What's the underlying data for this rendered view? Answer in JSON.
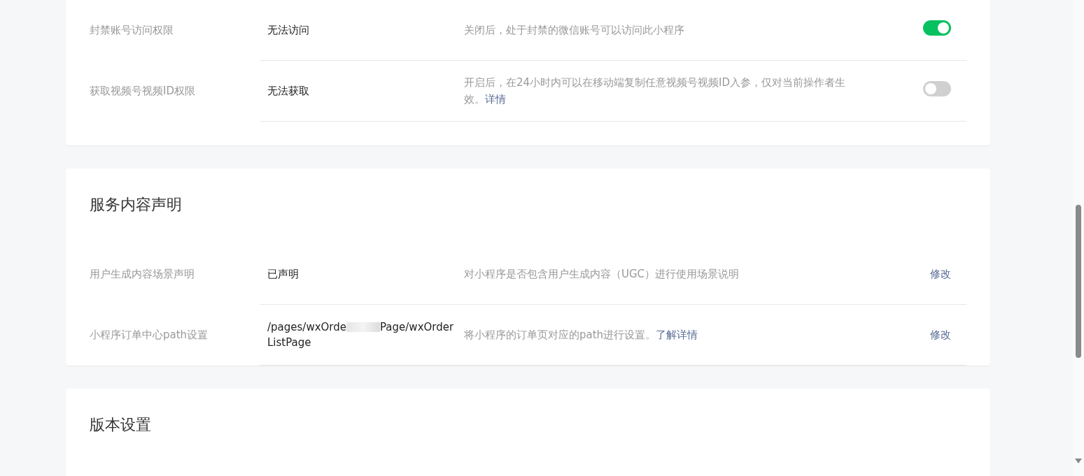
{
  "sections": [
    {
      "rows": [
        {
          "label": "封禁账号访问权限",
          "value": [
            "无法访问"
          ],
          "description": "关闭后，处于封禁的微信账号可以访问此小程序",
          "link": null,
          "action": {
            "kind": "switch",
            "on": true
          }
        },
        {
          "label": "获取视频号视频ID权限",
          "value": [
            "无法获取"
          ],
          "description": "开启后，在24小时内可以在移动端复制任意视频号视频ID入参，仅对当前操作者生效。",
          "link": "详情",
          "action": {
            "kind": "switch",
            "on": false
          }
        }
      ]
    },
    {
      "title": "服务内容声明",
      "rows": [
        {
          "label": "用户生成内容场景声明",
          "value": [
            "已声明"
          ],
          "description": "对小程序是否包含用户生成内容（UGC）进行使用场景说明",
          "link": null,
          "action": {
            "kind": "link",
            "text": "修改"
          }
        },
        {
          "label": "小程序订单中心path设置",
          "value": [
            "/pages/wxOrde",
            "Page/wxOrderListPage"
          ],
          "description": "将小程序的订单页对应的path进行设置。",
          "link": "了解详情",
          "action": {
            "kind": "link",
            "text": "修改"
          }
        }
      ]
    },
    {
      "title": "版本设置"
    }
  ]
}
